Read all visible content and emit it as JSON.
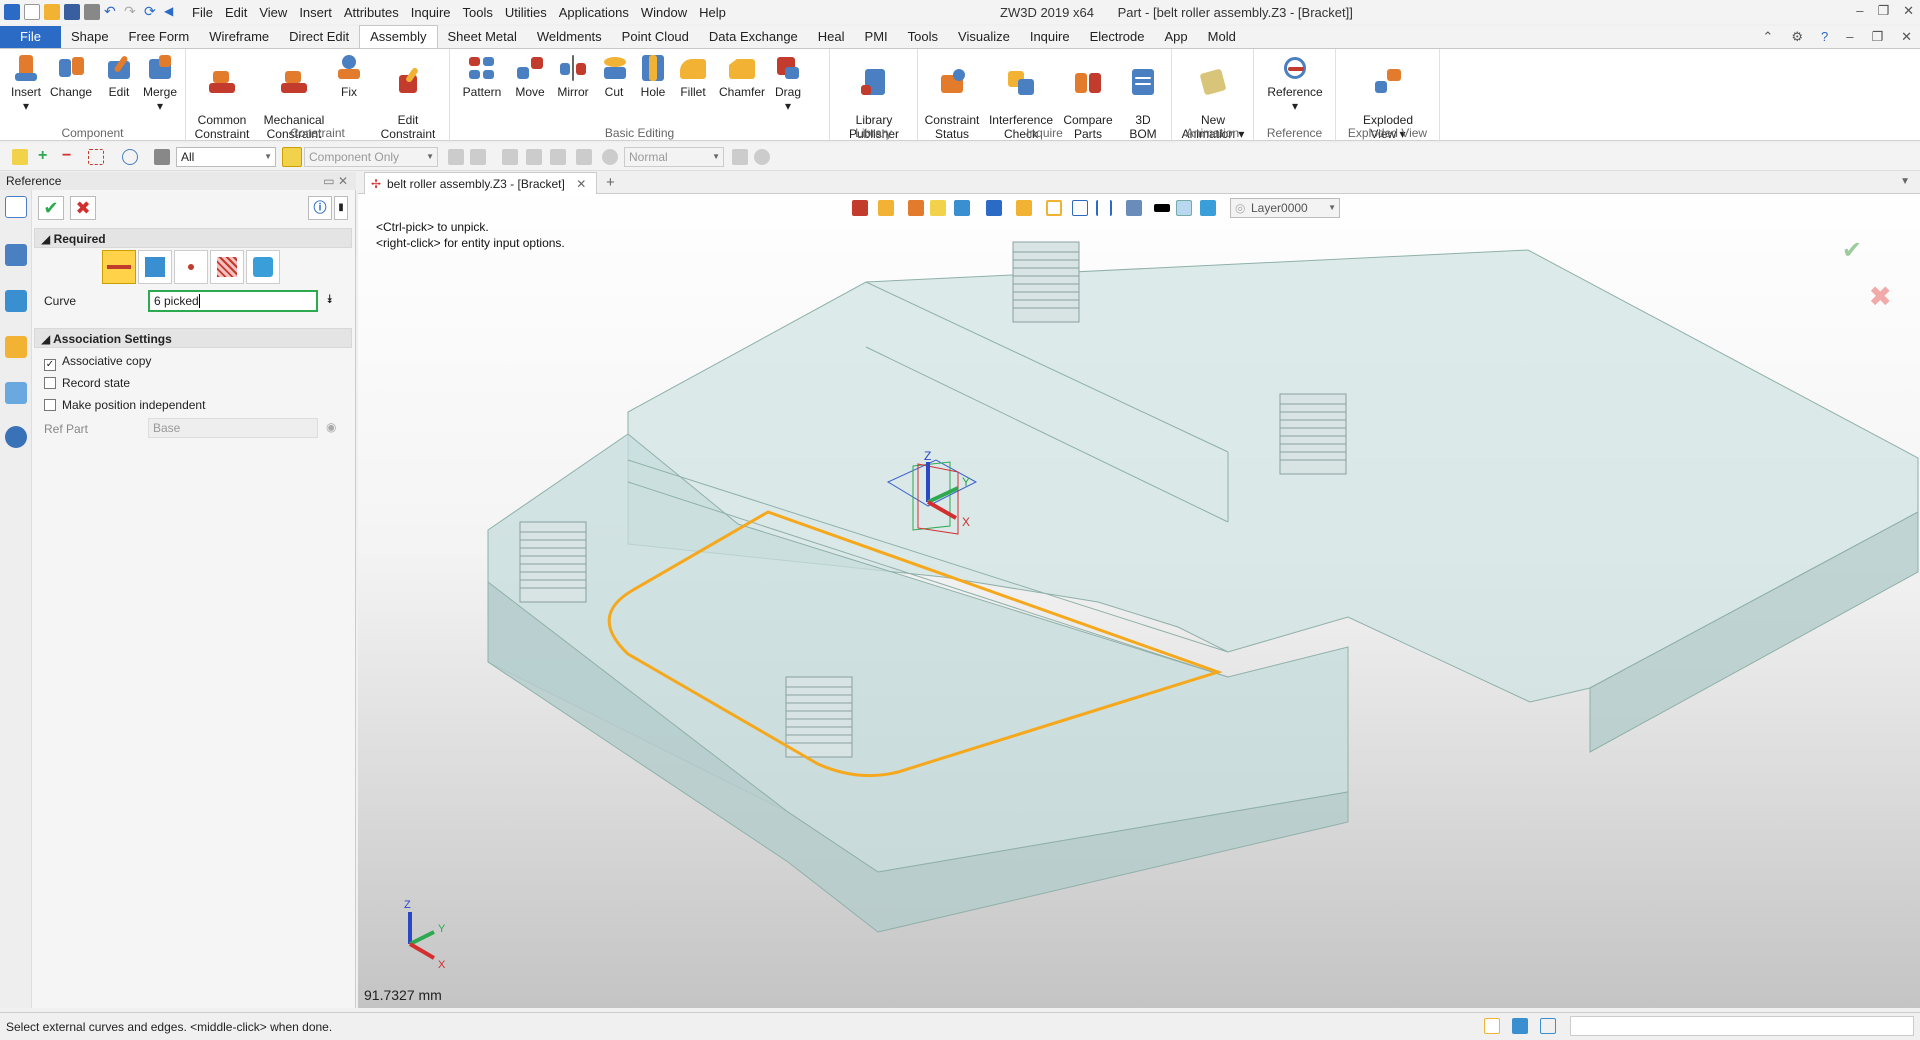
{
  "titlebar": {
    "menu": [
      "File",
      "Edit",
      "View",
      "Insert",
      "Attributes",
      "Inquire",
      "Tools",
      "Utilities",
      "Applications",
      "Window",
      "Help"
    ],
    "app_title": "ZW3D 2019  x64",
    "doc_title": "Part - [belt roller assembly.Z3 - [Bracket]]"
  },
  "tabs": [
    "File",
    "Shape",
    "Free Form",
    "Wireframe",
    "Direct Edit",
    "Assembly",
    "Sheet Metal",
    "Weldments",
    "Point Cloud",
    "Data Exchange",
    "Heal",
    "PMI",
    "Tools",
    "Visualize",
    "Inquire",
    "Electrode",
    "App",
    "Mold"
  ],
  "active_tab": "Assembly",
  "ribbon": {
    "component": {
      "label": "Component",
      "insert": "Insert",
      "change": "Change",
      "edit": "Edit",
      "merge": "Merge"
    },
    "constraint": {
      "label": "Constraint",
      "common": "Common\nConstraint",
      "mechanical": "Mechanical\nConstraint",
      "fix": "Fix",
      "edit": "Edit\nConstraint"
    },
    "basic_editing": {
      "label": "Basic Editing",
      "pattern": "Pattern",
      "move": "Move",
      "mirror": "Mirror",
      "cut": "Cut",
      "hole": "Hole",
      "fillet": "Fillet",
      "chamfer": "Chamfer",
      "drag": "Drag"
    },
    "library": {
      "label": "Library",
      "publisher": "Library\nPublisher"
    },
    "inquire": {
      "label": "Inquire",
      "status": "Constraint\nStatus",
      "interference": "Interference\nCheck",
      "compare": "Compare\nParts",
      "bom": "3D\nBOM"
    },
    "animation": {
      "label": "Animation",
      "new": "New\nAnimation"
    },
    "reference": {
      "label": "Reference",
      "reference": "Reference"
    },
    "exploded": {
      "label": "Exploded View",
      "exploded": "Exploded\nView"
    }
  },
  "toolbar": {
    "filter_value": "All",
    "scope_value": "Component Only",
    "render_value": "Normal",
    "layer_value": "Layer0000"
  },
  "panel": {
    "title": "Reference",
    "required_label": "Required",
    "curve_label": "Curve",
    "curve_value": "6 picked",
    "assoc_label": "Association Settings",
    "associative_copy": "Associative copy",
    "record_state": "Record state",
    "position_independent": "Make position independent",
    "ref_part_label": "Ref Part",
    "ref_part_value": "Base"
  },
  "checkboxes": {
    "associative_copy": true,
    "record_state": false,
    "position_independent": false
  },
  "doc_tab": "belt roller assembly.Z3 - [Bracket]",
  "viewport": {
    "hint_line1": "<Ctrl-pick> to unpick.",
    "hint_line2": "<right-click> for entity input options.",
    "measurement": "91.7327 mm",
    "axis_x": "X",
    "axis_y": "Y",
    "axis_z": "Z"
  },
  "status": {
    "message": "Select external curves and edges.  <middle-click> when done."
  },
  "colors": {
    "file_tab": "#2b6bc5",
    "highlight_curve": "#f5a81c",
    "ok_green": "#2da94f",
    "cancel_red": "#d32f2f",
    "part_fill": "#cfe2e2"
  }
}
